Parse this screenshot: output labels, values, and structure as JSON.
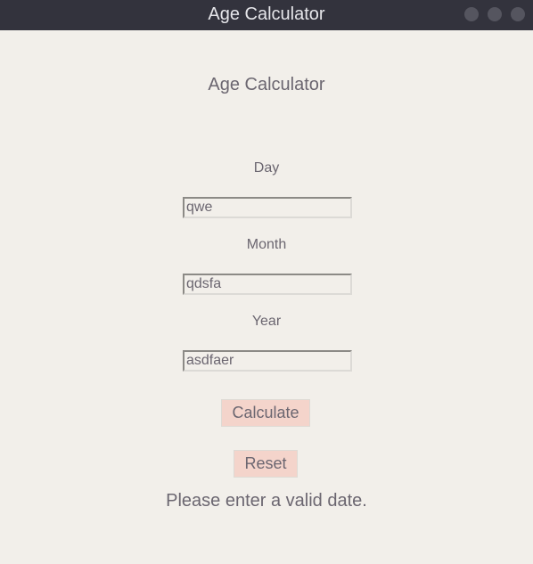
{
  "window": {
    "title": "Age Calculator",
    "controls": [
      "minimize",
      "maximize",
      "close"
    ]
  },
  "heading": "Age Calculator",
  "fields": [
    {
      "label": "Day",
      "value": "qwe"
    },
    {
      "label": "Month",
      "value": "qdsfa"
    },
    {
      "label": "Year",
      "value": "asdfaer"
    }
  ],
  "buttons": {
    "calculate": "Calculate",
    "reset": "Reset"
  },
  "message": "Please enter a valid date.",
  "colors": {
    "titlebar": "#33333d",
    "background": "#f2efea",
    "button": "#f4d4cb",
    "text": "#6b6670"
  }
}
